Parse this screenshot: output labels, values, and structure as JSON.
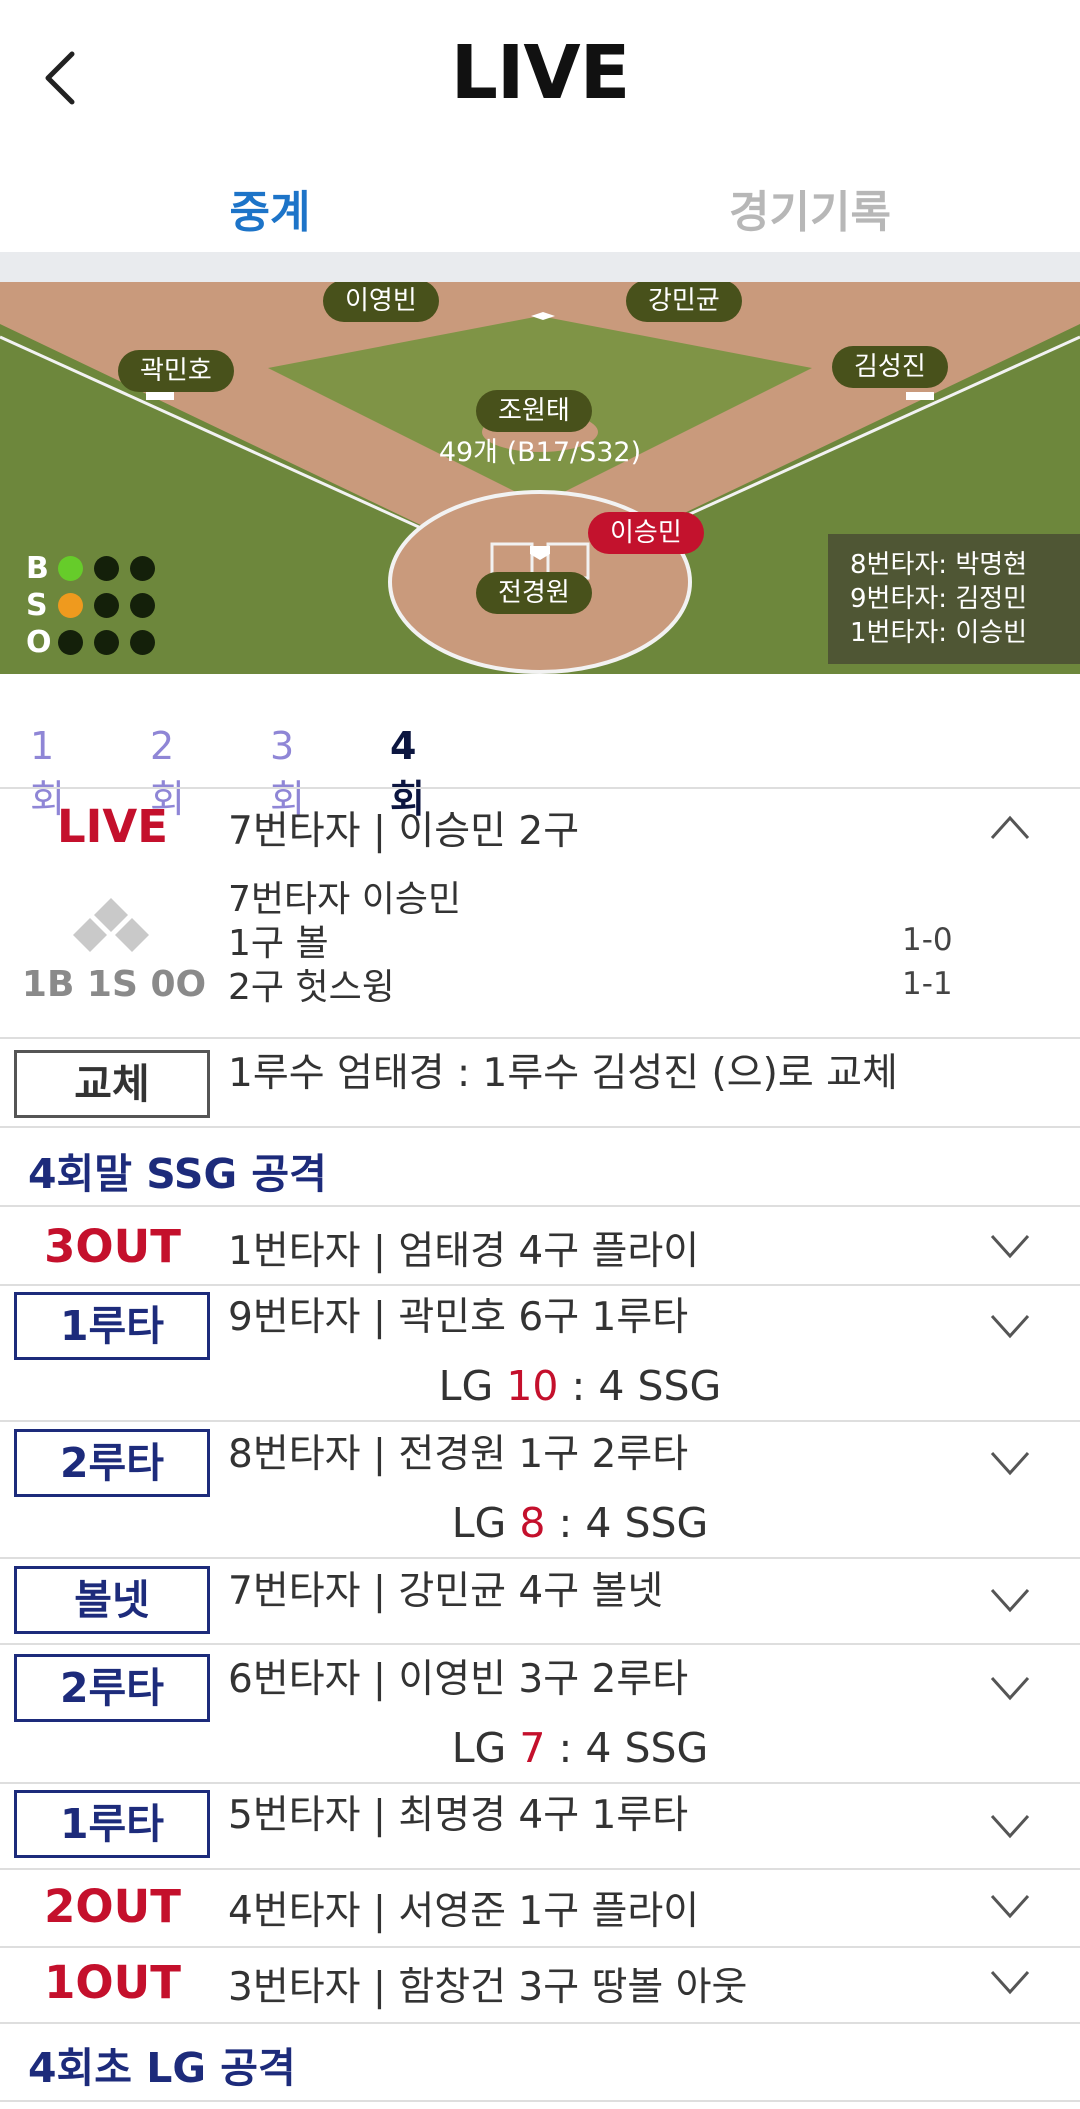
{
  "header": {
    "title": "LIVE"
  },
  "tabs": [
    {
      "label": "중계"
    },
    {
      "label": "경기기록"
    }
  ],
  "field": {
    "players": {
      "second_left": "이영빈",
      "second_right": "강민균",
      "third_base": "곽민호",
      "first_base": "김성진",
      "pitcher": "조원태",
      "batter": "이승민",
      "catcher": "전경원"
    },
    "pitch_count": "49개 (B17/S32)",
    "bso": {
      "b_label": "B",
      "s_label": "S",
      "o_label": "O",
      "balls": 1,
      "strikes": 1,
      "outs": 0
    },
    "upcoming": [
      "8번타자: 박명현",
      "9번타자: 김정민",
      "1번타자: 이승빈"
    ]
  },
  "innings": [
    "1회",
    "2회",
    "3회",
    "4회"
  ],
  "live": {
    "badge": "LIVE",
    "headline": "7번타자 | 이승민 2구",
    "count_text": "1B 1S 0O",
    "lines": [
      {
        "text": "7번타자 이승민",
        "count": ""
      },
      {
        "text": "1구 볼",
        "count": "1-0"
      },
      {
        "text": "2구 헛스윙",
        "count": "1-1"
      }
    ]
  },
  "events": {
    "sub": {
      "badge": "교체",
      "text": "1루수 엄태경 : 1루수 김성진 (으)로 교체"
    },
    "section_bottom": "4회말 SSG 공격",
    "e1": {
      "badge": "3OUT",
      "text": "1번타자 | 엄태경 4구 플라이"
    },
    "e2": {
      "badge": "1루타",
      "text": "9번타자 | 곽민호 6구 1루타",
      "score_pre": "LG ",
      "score_hl": "10",
      "score_post": " : 4 SSG"
    },
    "e3": {
      "badge": "2루타",
      "text": "8번타자 | 전경원 1구 2루타",
      "score_pre": "LG ",
      "score_hl": "8",
      "score_post": " : 4 SSG"
    },
    "e4": {
      "badge": "볼넷",
      "text": "7번타자 | 강민균 4구 볼넷"
    },
    "e5": {
      "badge": "2루타",
      "text": "6번타자 | 이영빈 3구 2루타",
      "score_pre": "LG ",
      "score_hl": "7",
      "score_post": " : 4 SSG"
    },
    "e6": {
      "badge": "1루타",
      "text": "5번타자 | 최명경 4구 1루타"
    },
    "e7": {
      "badge": "2OUT",
      "text": "4번타자 | 서영준 1구 플라이"
    },
    "e8": {
      "badge": "1OUT",
      "text": "3번타자 | 함창건 3구 땅볼 아웃"
    },
    "section_top": "4회초 LG 공격"
  },
  "colors": {
    "accent_blue": "#1d74c8",
    "navy": "#1d2b7b",
    "red": "#c4102c",
    "grass": "#6f8a3e",
    "dirt": "#c99878"
  }
}
